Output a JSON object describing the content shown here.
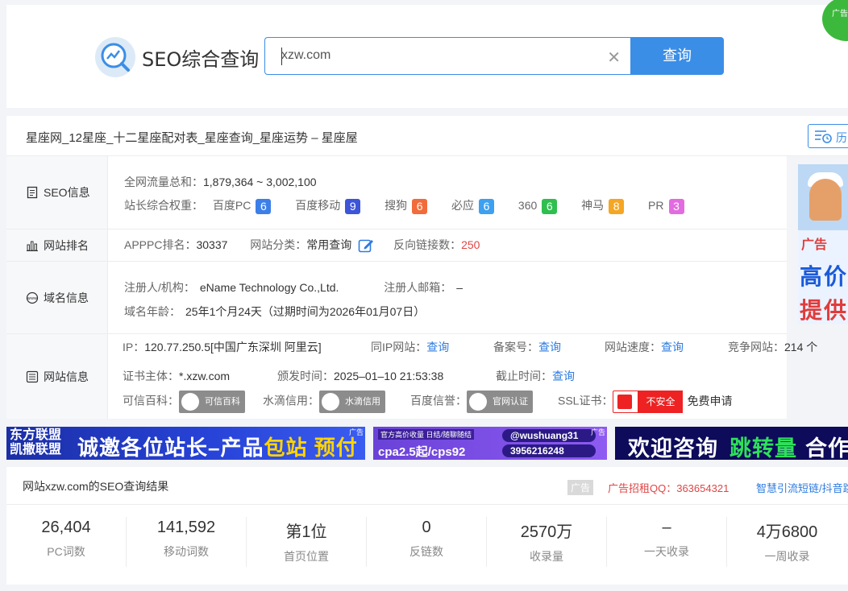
{
  "header": {
    "logo_text": "SEO综合查询",
    "search_value": "xzw.com",
    "search_button": "查询",
    "corner_ad": "广告"
  },
  "title_bar": {
    "site_title": "星座网_12星座_十二星座配对表_星座查询_星座运势 – 星座屋",
    "history_label": "历"
  },
  "seo_info": {
    "label": "SEO信息",
    "traffic_label": "全网流量总和：",
    "traffic_value": "1,879,364 ~ 3,002,100",
    "weight_label": "站长综合权重：",
    "weights": [
      {
        "name": "百度PC",
        "value": "6",
        "color": "#3d7fe8"
      },
      {
        "name": "百度移动",
        "value": "9",
        "color": "#3d55d8"
      },
      {
        "name": "搜狗",
        "value": "6",
        "color": "#f26b3a"
      },
      {
        "name": "必应",
        "value": "6",
        "color": "#3da0f0"
      },
      {
        "name": "360",
        "value": "6",
        "color": "#2fbf4f"
      },
      {
        "name": "神马",
        "value": "8",
        "color": "#f5a623"
      },
      {
        "name": "PR",
        "value": "3",
        "color": "#e36be0"
      }
    ]
  },
  "ranking": {
    "label": "网站排名",
    "apppc_label": "APPPC排名：",
    "apppc_value": "30337",
    "category_label": "网站分类：",
    "category_value": "常用查询",
    "backlinks_label": "反向链接数：",
    "backlinks_value": "250"
  },
  "domain": {
    "label": "域名信息",
    "registrant_label": "注册人/机构：",
    "registrant_value": "eName Technology Co.,Ltd.",
    "email_label": "注册人邮箱：",
    "email_value": "–",
    "age_label": "域名年龄：",
    "age_value": "25年1个月24天（过期时间为2026年01月07日）"
  },
  "website": {
    "label": "网站信息",
    "ip_label": "IP：",
    "ip_value": "120.77.250.5[中国广东深圳 阿里云]",
    "same_ip_label": "同IP网站：",
    "same_ip_link": "查询",
    "icp_label": "备案号：",
    "icp_link": "查询",
    "speed_label": "网站速度：",
    "speed_link": "查询",
    "competitor_label": "竞争网站：",
    "competitor_value": "214 个",
    "cert_subject_label": "证书主体：",
    "cert_subject_value": "*.xzw.com",
    "issue_label": "颁发时间：",
    "issue_value": "2025–01–10 21:53:38",
    "expire_label": "截止时间：",
    "expire_link": "查询",
    "kexin_label": "可信百科：",
    "kexin_stamp": "可信百科",
    "shuidi_label": "水滴信用：",
    "shuidi_stamp": "水滴信用",
    "baidu_label": "百度信誉：",
    "baidu_stamp": "官网认证",
    "ssl_label": "SSL证书：",
    "ssl_status": "不安全",
    "ssl_apply": "免费申请"
  },
  "side_ad": {
    "tag": "广告",
    "line1": "高价",
    "line2": "提供"
  },
  "banners": {
    "b1_small1": "东方联盟",
    "b1_small2": "凯撒联盟",
    "b1_main": "诚邀各位站长–产品",
    "b1_hl": "包站 预付",
    "b1_tag": "广告",
    "b2_line1": "官方高价收量 日结/随聊随结",
    "b2_line2": "cpa2.5起/cps92",
    "b2_pill1": "@wushuang31",
    "b2_pill2": "3956216248",
    "b2_tag": "广告",
    "b3_main": "欢迎咨询",
    "b3_hl": "跳转量",
    "b3_tail": "合作"
  },
  "results": {
    "title": "网站xzw.com的SEO查询结果",
    "ad_label": "广告",
    "ad_qq": "广告招租QQ：363654321",
    "ad_link": "智慧引流短链/抖音跳转",
    "stats": [
      {
        "value": "26,404",
        "label": "PC词数"
      },
      {
        "value": "141,592",
        "label": "移动词数"
      },
      {
        "value": "第1位",
        "label": "首页位置"
      },
      {
        "value": "0",
        "label": "反链数"
      },
      {
        "value": "2570万",
        "label": "收录量"
      },
      {
        "value": "–",
        "label": "一天收录"
      },
      {
        "value": "4万6800",
        "label": "一周收录"
      }
    ]
  }
}
